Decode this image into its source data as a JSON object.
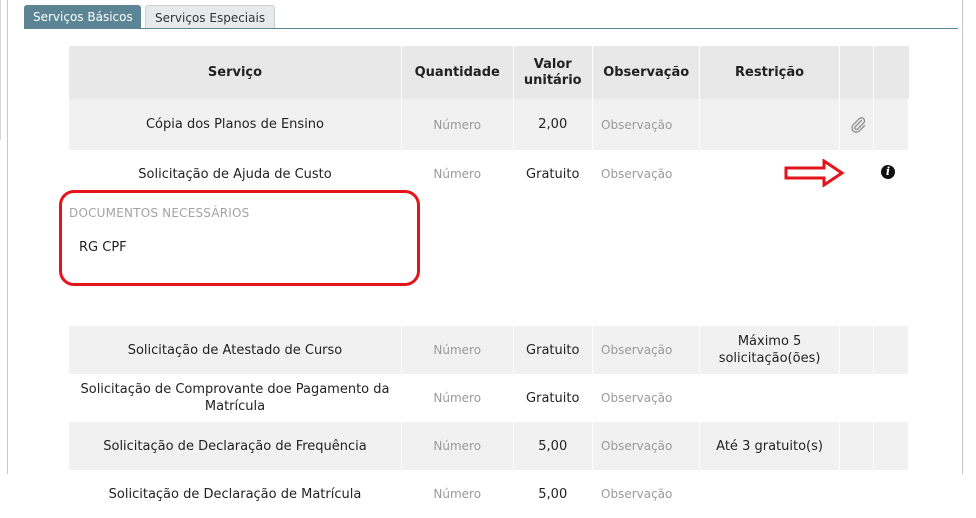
{
  "tabs": [
    {
      "label": "Serviços Básicos",
      "active": true
    },
    {
      "label": "Serviços Especiais",
      "active": false
    }
  ],
  "table": {
    "headers": {
      "servico": "Serviço",
      "quantidade": "Quantidade",
      "valor_line1": "Valor",
      "valor_line2": "unitário",
      "observacao": "Observação",
      "restricao": "Restrição"
    },
    "rows": [
      {
        "servico": "Cópia dos Planos de Ensino",
        "quantidade_placeholder": "Número",
        "valor": "2,00",
        "observacao_placeholder": "Observação",
        "restricao": "",
        "action_icon": "paperclip-icon"
      },
      {
        "servico": "Solicitação de Ajuda de Custo",
        "quantidade_placeholder": "Número",
        "valor": "Gratuito",
        "observacao_placeholder": "Observação",
        "restricao": "",
        "action_icon": "info-icon"
      },
      {
        "servico": "Solicitação de Atestado de Curso",
        "quantidade_placeholder": "Número",
        "valor": "Gratuito",
        "observacao_placeholder": "Observação",
        "restricao_line1": "Máximo 5",
        "restricao_line2": "solicitação(ões)"
      },
      {
        "servico_line1": "Solicitação de Comprovante doe Pagamento da",
        "servico_line2": "Matrícula",
        "quantidade_placeholder": "Número",
        "valor": "Gratuito",
        "observacao_placeholder": "Observação",
        "restricao": ""
      },
      {
        "servico": "Solicitação de Declaração de Frequência",
        "quantidade_placeholder": "Número",
        "valor": "5,00",
        "observacao_placeholder": "Observação",
        "restricao": "Até 3 gratuito(s)"
      },
      {
        "servico": "Solicitação de Declaração de Matrícula",
        "quantidade_placeholder": "Número",
        "valor": "5,00",
        "observacao_placeholder": "Observação",
        "restricao": ""
      }
    ],
    "documents": {
      "title": "DOCUMENTOS NECESSÁRIOS",
      "items": "RG CPF"
    }
  },
  "annotations": {
    "highlight_color": "#e4141b",
    "arrow_color": "#e4141b"
  },
  "colors": {
    "tab_active": "#5b8595",
    "header_bg": "#e8e8e8",
    "row_shade": "#f1f1f1"
  }
}
